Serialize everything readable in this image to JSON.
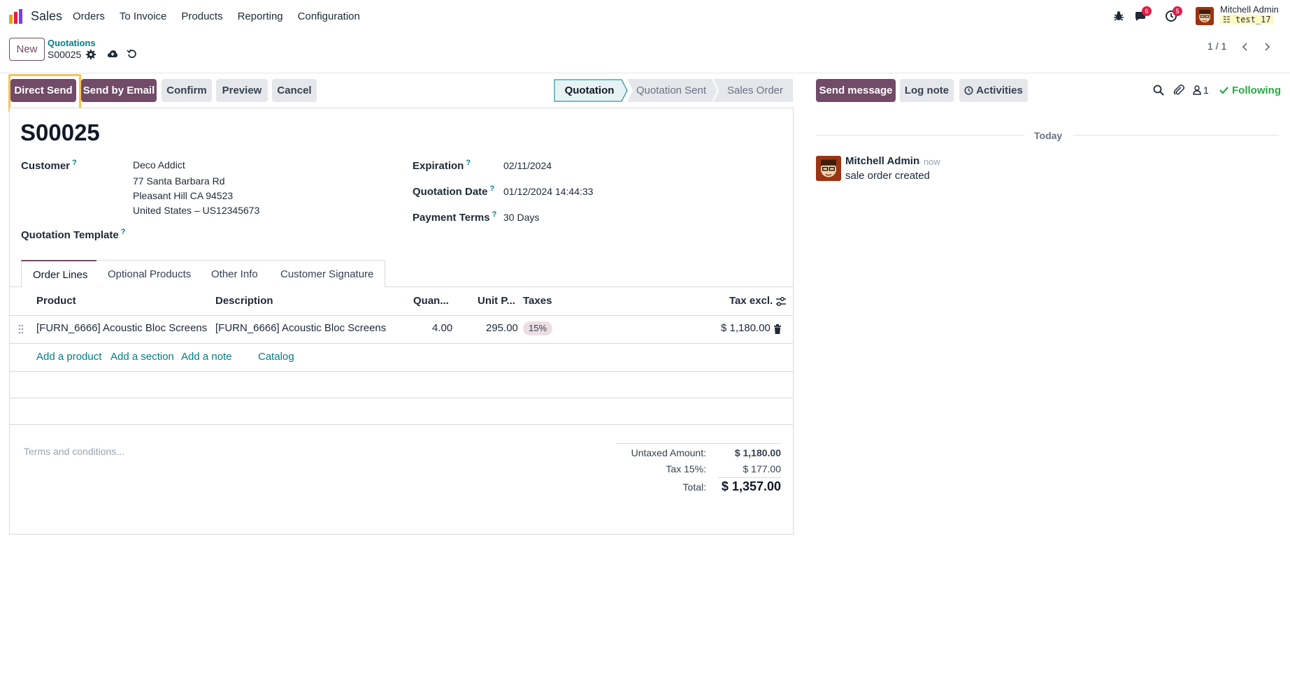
{
  "navbar": {
    "app_name": "Sales",
    "menu": [
      "Orders",
      "To Invoice",
      "Products",
      "Reporting",
      "Configuration"
    ],
    "messages_count": "6",
    "activities_count": "5",
    "user_name": "Mitchell Admin",
    "database": "test_17"
  },
  "control_panel": {
    "new_label": "New",
    "breadcrumb_parent": "Quotations",
    "breadcrumb_current": "S00025",
    "pager": "1 / 1"
  },
  "actions": {
    "direct_send": "Direct Send",
    "send_by_email": "Send by Email",
    "confirm": "Confirm",
    "preview": "Preview",
    "cancel": "Cancel"
  },
  "statusbar": {
    "stages": [
      "Quotation",
      "Quotation Sent",
      "Sales Order"
    ],
    "active": "Quotation"
  },
  "form": {
    "name": "S00025",
    "customer_label": "Customer",
    "customer_name": "Deco Addict",
    "customer_address": [
      "77 Santa Barbara Rd",
      "Pleasant Hill CA 94523",
      "United States – US12345673"
    ],
    "template_label": "Quotation Template",
    "expiration_label": "Expiration",
    "expiration": "02/11/2024",
    "quotation_date_label": "Quotation Date",
    "quotation_date": "01/12/2024 14:44:33",
    "payment_terms_label": "Payment Terms",
    "payment_terms": "30 Days",
    "help_mark": "?"
  },
  "tabs": [
    "Order Lines",
    "Optional Products",
    "Other Info",
    "Customer Signature"
  ],
  "order_lines": {
    "headers": {
      "product": "Product",
      "description": "Description",
      "quantity": "Quan...",
      "unit_price": "Unit P...",
      "taxes": "Taxes",
      "subtotal": "Tax excl."
    },
    "rows": [
      {
        "product": "[FURN_6666] Acoustic Bloc Screens",
        "description": "[FURN_6666] Acoustic Bloc Screens",
        "quantity": "4.00",
        "unit_price": "295.00",
        "tax": "15%",
        "subtotal": "$ 1,180.00"
      }
    ],
    "add_product": "Add a product",
    "add_section": "Add a section",
    "add_note": "Add a note",
    "catalog": "Catalog"
  },
  "totals": {
    "terms_placeholder": "Terms and conditions...",
    "untaxed_label": "Untaxed Amount:",
    "untaxed_value": "$ 1,180.00",
    "tax_label": "Tax 15%:",
    "tax_value": "$ 177.00",
    "total_label": "Total:",
    "total_value": "$ 1,357.00"
  },
  "chatter": {
    "send_message": "Send message",
    "log_note": "Log note",
    "activities": "Activities",
    "followers_count": "1",
    "following": "Following",
    "today": "Today",
    "message": {
      "author": "Mitchell Admin",
      "time": "- now",
      "body": "sale order created"
    }
  },
  "colors": {
    "brand": "#714b67",
    "link": "#017e84",
    "success": "#28a745",
    "highlight": "#f5c25c"
  }
}
